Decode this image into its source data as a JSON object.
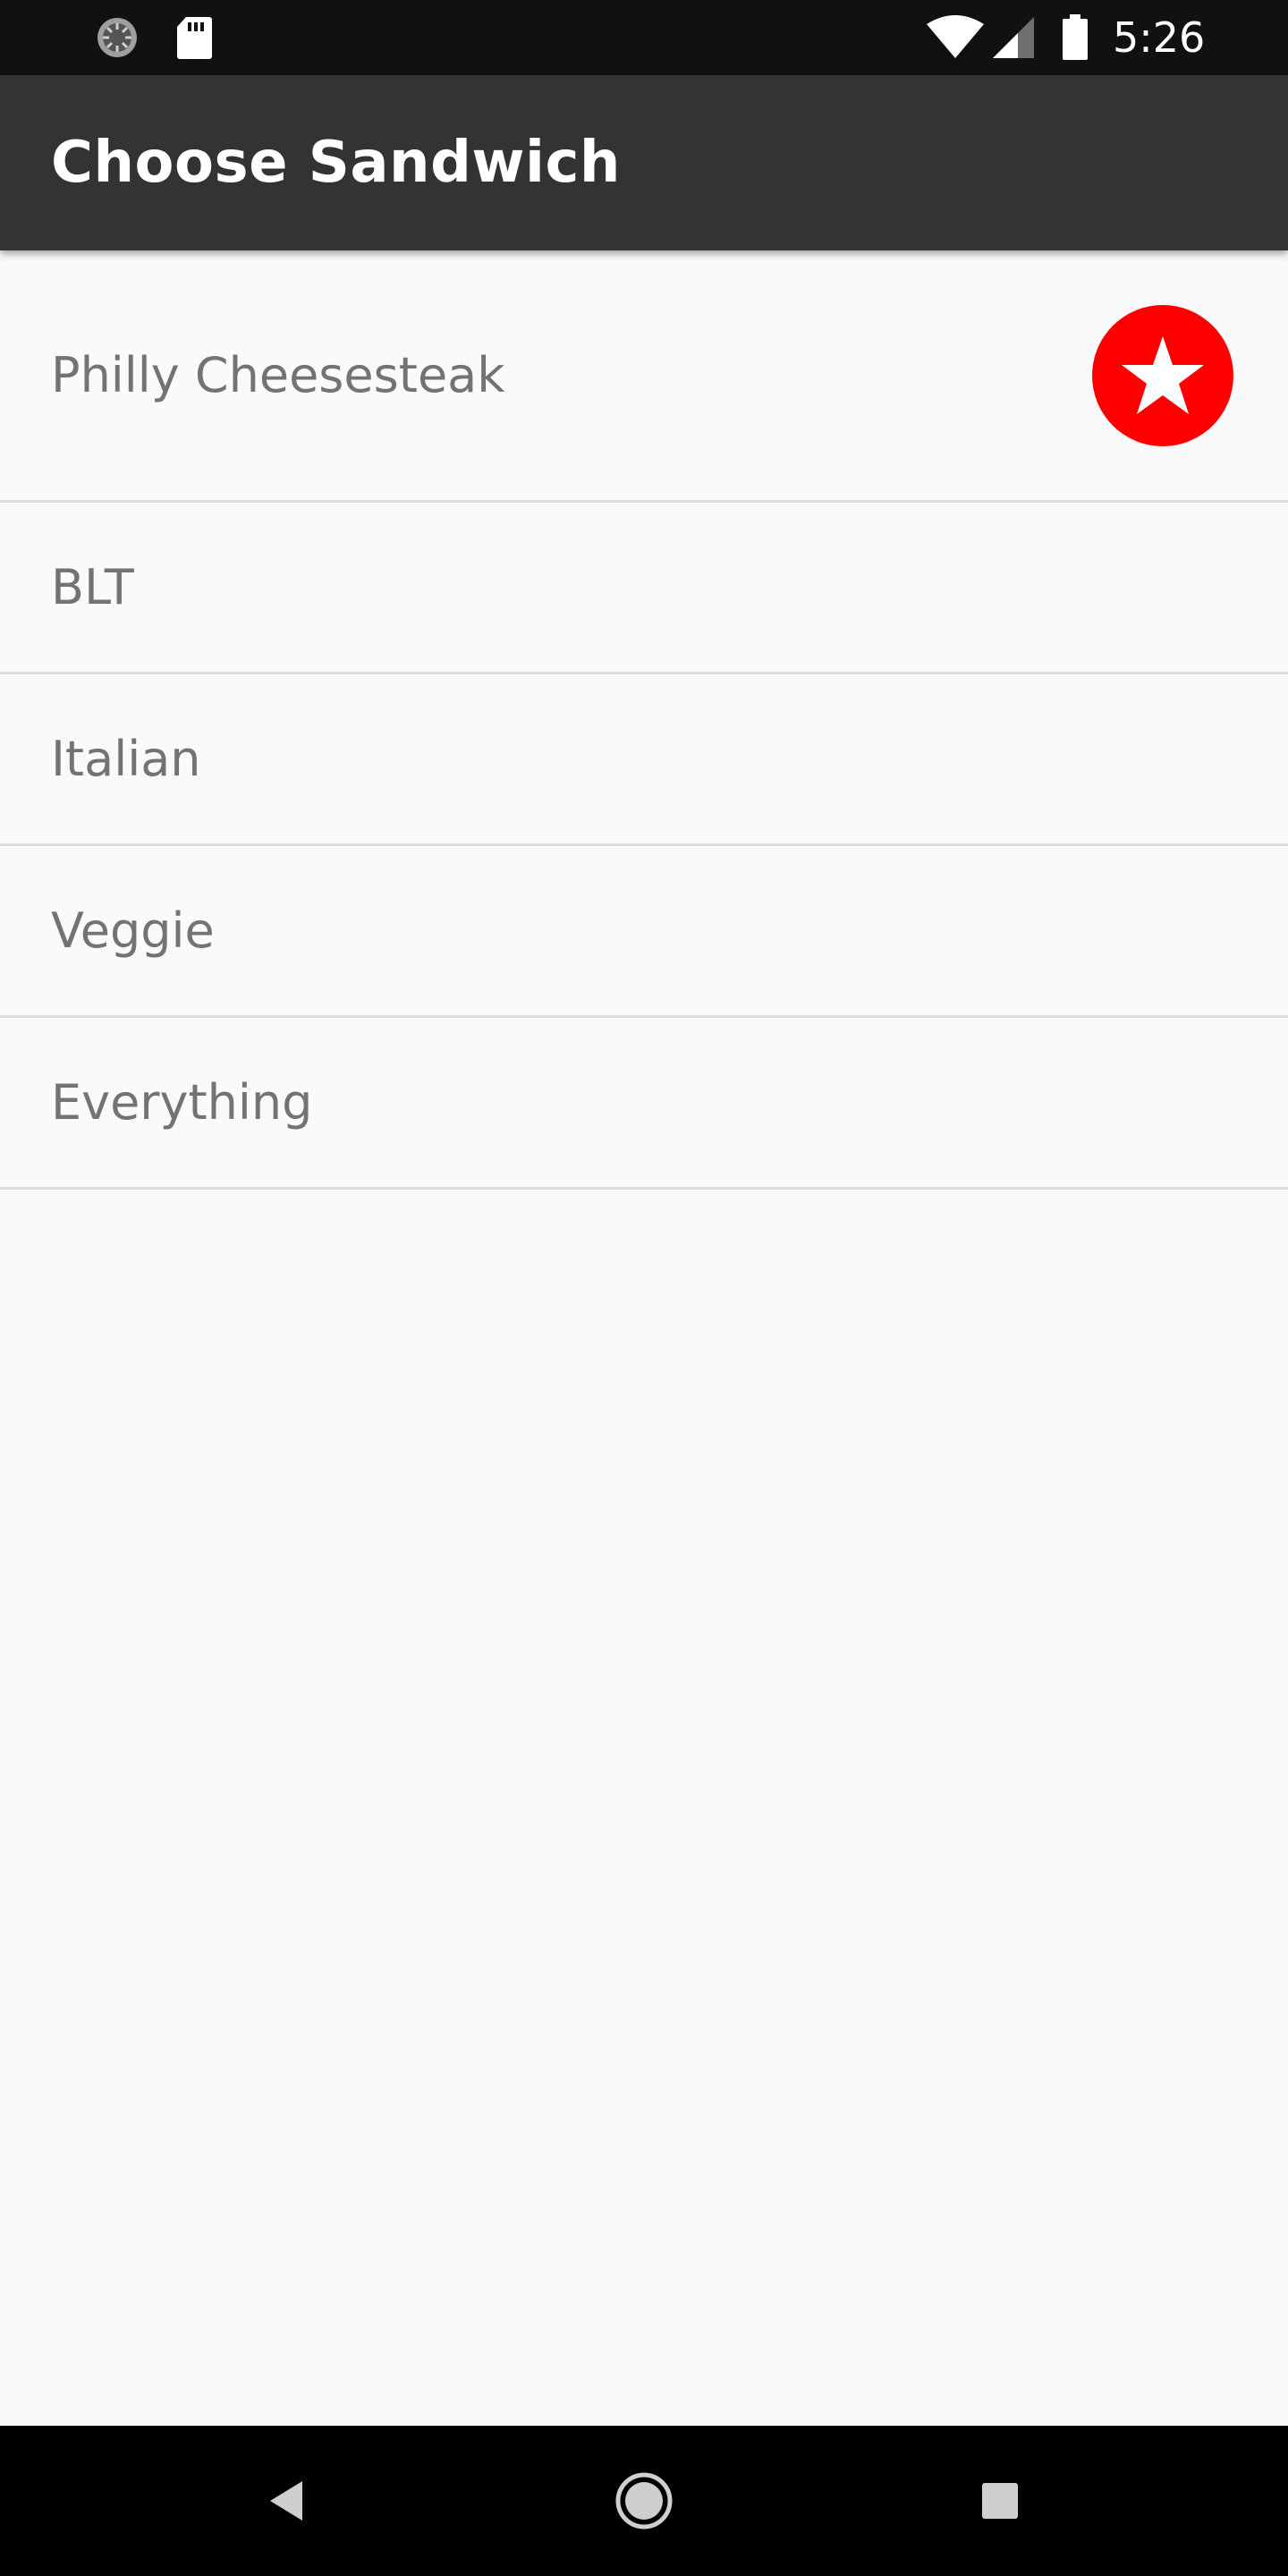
{
  "status_bar": {
    "time": "5:26",
    "icons": [
      "sync-icon",
      "sd-card-icon",
      "wifi-icon",
      "cell-signal-icon",
      "battery-icon"
    ]
  },
  "app_bar": {
    "title": "Choose Sandwich"
  },
  "sandwiches": [
    {
      "label": "Philly Cheesesteak",
      "favorite": true
    },
    {
      "label": "BLT",
      "favorite": false
    },
    {
      "label": "Italian",
      "favorite": false
    },
    {
      "label": "Veggie",
      "favorite": false
    },
    {
      "label": "Everything",
      "favorite": false
    }
  ],
  "colors": {
    "status_bar": "#111111",
    "app_bar": "#333333",
    "background": "#fafafa",
    "favorite_accent": "#ff0000",
    "item_text": "#737373",
    "divider": "#dcdcdc",
    "nav_bar": "#000000"
  },
  "nav_bar": {
    "buttons": [
      "back-icon",
      "home-icon",
      "recents-icon"
    ]
  }
}
